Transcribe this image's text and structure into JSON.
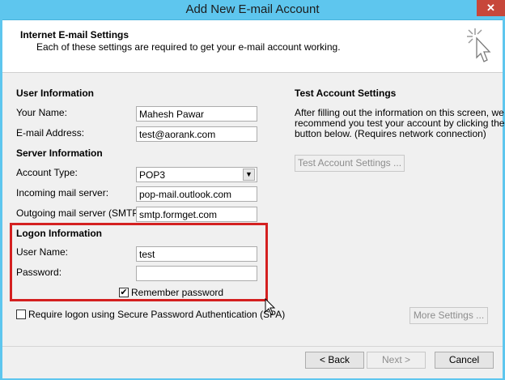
{
  "window": {
    "title": "Add New E-mail Account",
    "close_glyph": "✕"
  },
  "header": {
    "title": "Internet E-mail Settings",
    "description": "Each of these settings are required to get your e-mail account working.",
    "icon": "wizard-cursor-icon"
  },
  "user_info": {
    "title": "User Information",
    "name_label": "Your Name:",
    "name_value": "Mahesh Pawar",
    "email_label": "E-mail Address:",
    "email_value": "test@aorank.com"
  },
  "server_info": {
    "title": "Server Information",
    "account_type_label": "Account Type:",
    "account_type_value": "POP3",
    "incoming_label": "Incoming mail server:",
    "incoming_value": "pop-mail.outlook.com",
    "outgoing_label": "Outgoing mail server (SMTP):",
    "outgoing_value": "smtp.formget.com"
  },
  "logon_info": {
    "title": "Logon Information",
    "username_label": "User Name:",
    "username_value": "test",
    "password_label": "Password:",
    "password_value": "",
    "remember_label": "Remember password",
    "remember_checked": true,
    "spa_label": "Require logon using Secure Password Authentication (SPA)",
    "spa_checked": false
  },
  "test_settings": {
    "title": "Test Account Settings",
    "description_line1": "After filling out the information on this screen, we",
    "description_line2": "recommend you test your account by clicking the",
    "description_line3": "button below. (Requires network connection)",
    "test_button": "Test Account Settings ..."
  },
  "buttons": {
    "more_settings": "More Settings ...",
    "back": "< Back",
    "next": "Next >",
    "cancel": "Cancel"
  },
  "colors": {
    "titlebar": "#5ec6ee",
    "close": "#c7473a",
    "highlight": "#d42020"
  }
}
